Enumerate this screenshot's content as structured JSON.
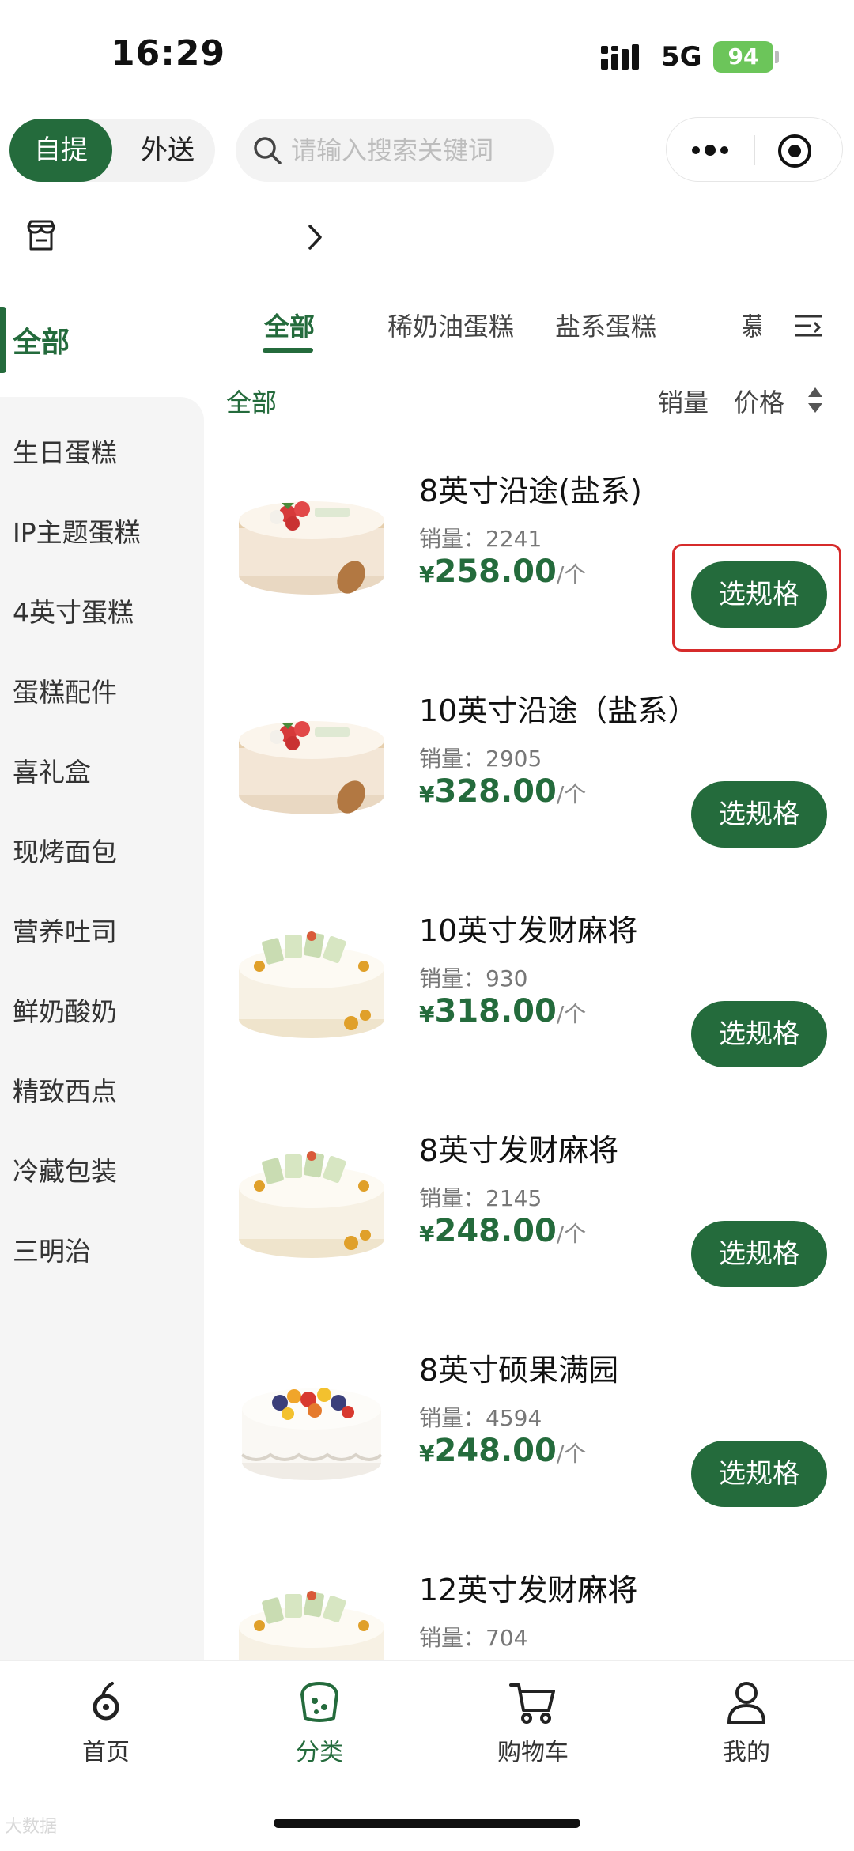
{
  "status_bar": {
    "time": "16:29",
    "network": "5G",
    "battery": "94"
  },
  "header": {
    "mode_active": "自提",
    "mode_other": "外送",
    "search_placeholder": "请输入搜索关键词"
  },
  "store": {
    "name": ""
  },
  "sidebar": {
    "active": "全部",
    "items": [
      "生日蛋糕",
      "IP主题蛋糕",
      "4英寸蛋糕",
      "蛋糕配件",
      "喜礼盒",
      "现烤面包",
      "营养吐司",
      "鲜奶酸奶",
      "精致西点",
      "冷藏包装",
      "三明治"
    ]
  },
  "tabs": {
    "items": [
      "全部",
      "稀奶油蛋糕",
      "盐系蛋糕"
    ],
    "clipped": "慕"
  },
  "sort": {
    "current": "全部",
    "sales": "销量",
    "price": "价格"
  },
  "product_labels": {
    "sales_prefix": "销量：",
    "currency": "¥",
    "unit": "/个",
    "button": "选规格"
  },
  "products": [
    {
      "name": "8英寸沿途(盐系)",
      "sales": "2241",
      "price": "258.00"
    },
    {
      "name": "10英寸沿途（盐系）",
      "sales": "2905",
      "price": "328.00"
    },
    {
      "name": "10英寸发财麻将",
      "sales": "930",
      "price": "318.00"
    },
    {
      "name": "8英寸发财麻将",
      "sales": "2145",
      "price": "248.00"
    },
    {
      "name": "8英寸硕果满园",
      "sales": "4594",
      "price": "248.00"
    },
    {
      "name": "12英寸发财麻将",
      "sales": "704",
      "price": ""
    }
  ],
  "tabbar": {
    "items": [
      {
        "label": "首页",
        "icon": "home-icon"
      },
      {
        "label": "分类",
        "icon": "category-icon"
      },
      {
        "label": "购物车",
        "icon": "cart-icon"
      },
      {
        "label": "我的",
        "icon": "profile-icon"
      }
    ],
    "active_index": 1
  },
  "colors": {
    "accent": "#246b3c",
    "highlight": "#d62b2b",
    "battery": "#6cc55a"
  },
  "watermark": "大数据"
}
